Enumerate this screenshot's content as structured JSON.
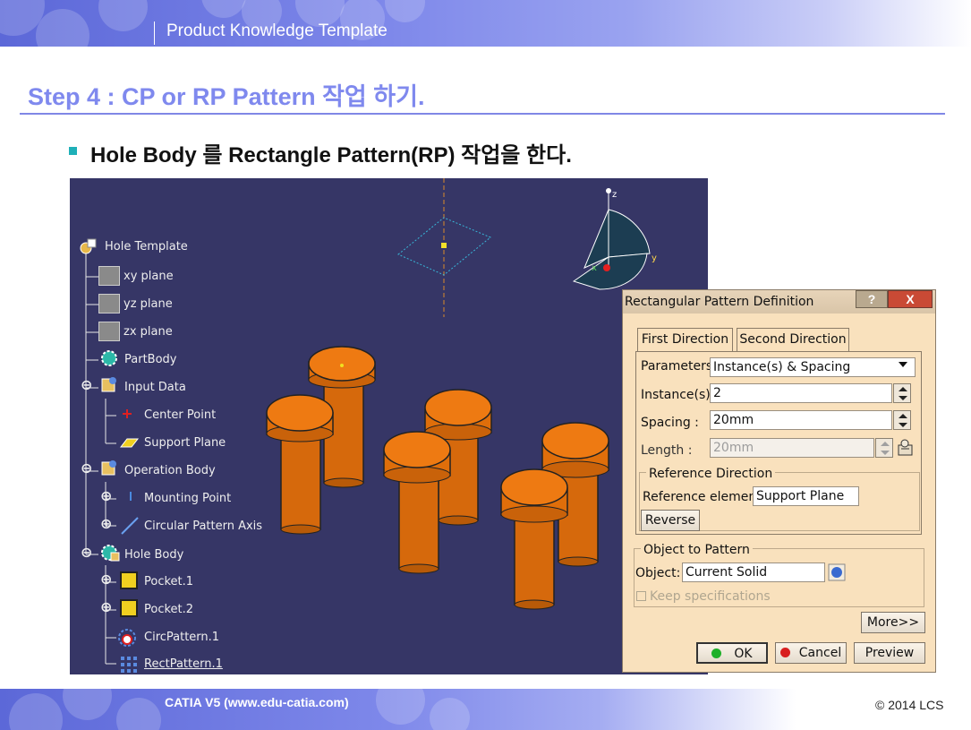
{
  "header": {
    "band_title": "Product Knowledge Template",
    "step_title": "Step 4 : CP or RP Pattern 작업 하기.",
    "bullet": "Hole Body 를 Rectangle Pattern(RP) 작업을 한다."
  },
  "tree": {
    "root": "Hole Template",
    "items": [
      {
        "label": "xy plane",
        "icon": "plane-icon"
      },
      {
        "label": "yz plane",
        "icon": "plane-icon"
      },
      {
        "label": "zx plane",
        "icon": "plane-icon"
      },
      {
        "label": "PartBody",
        "icon": "body-icon"
      },
      {
        "label": "Input Data",
        "icon": "geometrical-set-icon"
      },
      {
        "label": "Center Point",
        "icon": "point-icon"
      },
      {
        "label": "Support Plane",
        "icon": "plane-icon"
      },
      {
        "label": "Operation Body",
        "icon": "geometrical-set-icon"
      },
      {
        "label": "Mounting Point",
        "icon": "point-icon"
      },
      {
        "label": "Circular Pattern Axis",
        "icon": "line-icon"
      },
      {
        "label": "Hole Body",
        "icon": "body-icon"
      },
      {
        "label": "Pocket.1",
        "icon": "pocket-icon"
      },
      {
        "label": "Pocket.2",
        "icon": "pocket-icon"
      },
      {
        "label": "CircPattern.1",
        "icon": "circular-pattern-icon"
      },
      {
        "label": "RectPattern.1",
        "icon": "rectangular-pattern-icon"
      }
    ]
  },
  "compass": {
    "z": "z",
    "x": "x",
    "y": "y"
  },
  "dialog": {
    "title": "Rectangular Pattern Definition",
    "help": "?",
    "close": "X",
    "tabs": [
      "First Direction",
      "Second Direction"
    ],
    "parameters_label": "Parameters:",
    "parameters_value": "Instance(s) & Spacing",
    "instances_label": "Instance(s) :",
    "instances_value": "2",
    "spacing_label": "Spacing :",
    "spacing_value": "20mm",
    "length_label": "Length :",
    "length_value": "20mm",
    "ref_group": "Reference Direction",
    "ref_element_label": "Reference element:",
    "ref_element_value": "Support Plane",
    "reverse": "Reverse",
    "object_group": "Object to Pattern",
    "object_label": "Object:",
    "object_value": "Current Solid",
    "keep_spec": "Keep specifications",
    "more": "More>>",
    "ok": "OK",
    "cancel": "Cancel",
    "preview": "Preview"
  },
  "footer": {
    "left": "CATIA V5 (www.edu-catia.com)",
    "right": "© 2014 LCS"
  },
  "colors": {
    "accent": "#7f89ee",
    "viewport_bg": "#363666",
    "cylinder": "#e8770e",
    "dialog_bg": "#f9e1bd"
  }
}
